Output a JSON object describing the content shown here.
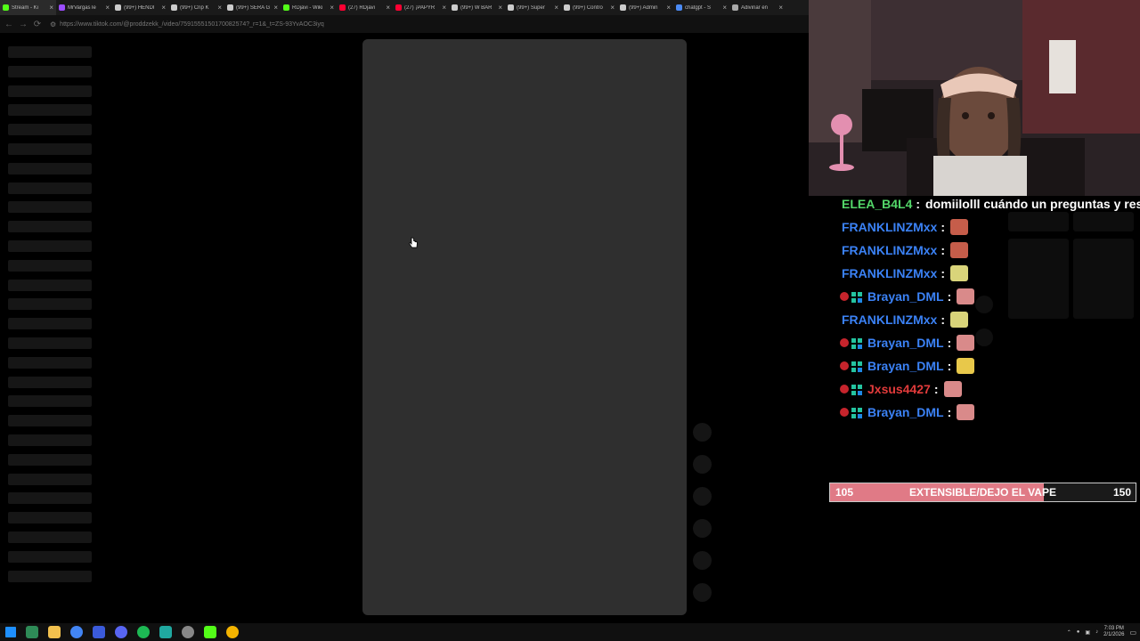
{
  "browser": {
    "tabs": [
      {
        "label": "Stream - Ki",
        "color": "#53fc18"
      },
      {
        "label": "MrVargasTe",
        "color": "#9b4dff"
      },
      {
        "label": "(99+) HENDI",
        "color": "#cccccc"
      },
      {
        "label": "(99+) Crip K",
        "color": "#cccccc"
      },
      {
        "label": "(99+) SERA G",
        "color": "#cccccc"
      },
      {
        "label": "RDjavi - Wiki",
        "color": "#53fc18"
      },
      {
        "label": "(27) RDjavi",
        "color": "#ff0033"
      },
      {
        "label": "(27) ¡PAPYR",
        "color": "#ff0033"
      },
      {
        "label": "(99+) W BAR",
        "color": "#cccccc"
      },
      {
        "label": "(99+) Super",
        "color": "#cccccc"
      },
      {
        "label": "(99+) Contro",
        "color": "#cccccc"
      },
      {
        "label": "(99+) Admin",
        "color": "#cccccc"
      },
      {
        "label": "chatgpt - S",
        "color": "#4b8bf5"
      },
      {
        "label": "Adivinar en",
        "color": "#aaaaaa"
      }
    ],
    "url": "https://www.tiktok.com/@proddzekk_/video/7591555150170082574?_r=1&_t=ZS-93YvAOC3iyq"
  },
  "chat": {
    "messages": [
      {
        "user": "ELEA_B4L4",
        "color": "#53d769",
        "badges": false,
        "text": "domiilolll cuándo un preguntas y respue",
        "emote": null
      },
      {
        "user": "FRANKLINZMxx",
        "color": "#3b82f6",
        "badges": false,
        "text": "",
        "emote": "#c65d4a"
      },
      {
        "user": "FRANKLINZMxx",
        "color": "#3b82f6",
        "badges": false,
        "text": "",
        "emote": "#c65d4a"
      },
      {
        "user": "FRANKLINZMxx",
        "color": "#3b82f6",
        "badges": false,
        "text": "",
        "emote": "#d9d47a"
      },
      {
        "user": "Brayan_DML",
        "color": "#3b82f6",
        "badges": true,
        "text": "",
        "emote": "#d98a8a"
      },
      {
        "user": "FRANKLINZMxx",
        "color": "#3b82f6",
        "badges": false,
        "text": "",
        "emote": "#d9d47a"
      },
      {
        "user": "Brayan_DML",
        "color": "#3b82f6",
        "badges": true,
        "text": "",
        "emote": "#d98a8a"
      },
      {
        "user": "Brayan_DML",
        "color": "#3b82f6",
        "badges": true,
        "text": "",
        "emote": "#e8c84a"
      },
      {
        "user": "Jxsus4427",
        "color": "#e23b3b",
        "badges": true,
        "text": "",
        "emote": "#d98a8a"
      },
      {
        "user": "Brayan_DML",
        "color": "#3b82f6",
        "badges": true,
        "text": "",
        "emote": "#d98a8a"
      }
    ],
    "colon": ":"
  },
  "goal": {
    "current": "105",
    "target": "150",
    "label": "EXTENSIBLE/DEJO EL VAPE",
    "progress": 0.7
  },
  "taskbar": {
    "icons": [
      {
        "name": "windows-start-icon",
        "color": "#1e90ff"
      },
      {
        "name": "terminal-icon",
        "color": "#2e8b57"
      },
      {
        "name": "file-explorer-icon",
        "color": "#f2c14e"
      },
      {
        "name": "chrome-icon",
        "color": "#4285f4"
      },
      {
        "name": "app-icon",
        "color": "#3b5bdb"
      },
      {
        "name": "discord-icon",
        "color": "#5865f2"
      },
      {
        "name": "spotify-icon",
        "color": "#1db954"
      },
      {
        "name": "app-icon-2",
        "color": "#20a8a0"
      },
      {
        "name": "obs-icon",
        "color": "#888888"
      },
      {
        "name": "kick-icon",
        "color": "#53fc18"
      },
      {
        "name": "chrome-canary-icon",
        "color": "#f4b400"
      }
    ],
    "time": "7:03 PM",
    "date": "2/1/2026"
  }
}
